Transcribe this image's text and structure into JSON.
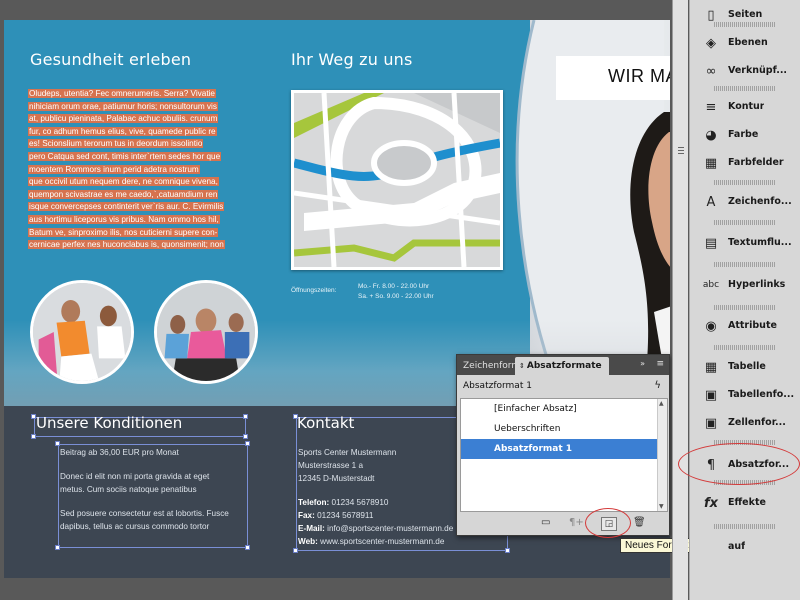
{
  "document": {
    "heading_gesundheit": "Gesundheit erleben",
    "heading_weg": "Ihr Weg zu uns",
    "lorem_lines": [
      "Oludeps, utentia? Fec omnerumeris. Serra? Vivatie",
      "nihiciam orum orae, patiumur horis; nonsultorum vis",
      "at, publicu pieninata, Palabac achuc obuliis. crunum",
      "fur, co adhum hemus elius, vive, quamede public re",
      "es! Scionslium terorum tus in deordum issolintio",
      "pero Catqua sed cont, timis inter`rtem sedes hor que",
      "moentem Rommors inum perid adetra nostrum",
      "que occivil utum nequem dere, ne comnique vivena,",
      "quempon scivastrae es me caedo,`,catuamdium ren",
      "isque convercepses continterit ver`ris aur. C. Evirmilis",
      "aus hortimu liceporus vis pribus. Nam ommo hos hil,",
      "Batum ve, sinproximo ilis, nos cuticierni supere con-",
      "cernicae perfex nes huconclabus is, quonsimenit; non"
    ],
    "hours_label": "Öffnungszeiten:",
    "hours_line1": "Mo.- Fr. 8.00 - 22.00 Uhr",
    "hours_line2": "Sa. + So. 9.00 - 22.00 Uhr",
    "wir_text": "WIR MAC",
    "heading_konditionen": "Unsere Konditionen",
    "heading_kontakt": "Kontakt",
    "konditionen_line1": "Beitrag ab 36,00 EUR pro Monat",
    "konditionen_para2_l1": "Donec id elit non mi porta gravida at eget",
    "konditionen_para2_l2": "metus. Cum sociis natoque penatibus",
    "konditionen_para3_l1": "Sed posuere consectetur est at lobortis. Fusce",
    "konditionen_para3_l2": "dapibus, tellus ac cursus commodo tortor",
    "kontakt_name": "Sports Center Mustermann",
    "kontakt_street": "Musterstrasse 1 a",
    "kontakt_city": "12345 D-Musterstadt",
    "telefon_label": "Telefon:",
    "telefon_value": " 01234 5678910",
    "fax_label": "Fax:",
    "fax_value": " 01234 5678911",
    "email_label": "E-Mail:",
    "email_value": " info@sportscenter-mustermann.de",
    "web_label": "Web:",
    "web_value": " www.sportscenter-mustermann.de"
  },
  "panel": {
    "tab_zeichen": "Zeichenformate",
    "tab_absatz": "Absatzformate",
    "collapse_icon": "»",
    "menu_icon": "≡",
    "current_format": "Absatzformat 1",
    "lightning_icon": "ϟ",
    "items": [
      "[Einfacher Absatz]",
      "Ueberschriften",
      "Absatzformat 1"
    ],
    "selected_index": 2,
    "tooltip": "Neues Format erstellen"
  },
  "dock": {
    "items": [
      {
        "label": "Seiten",
        "icon": "pages-icon",
        "glyph": "▯"
      },
      {
        "label": "Ebenen",
        "icon": "layers-icon",
        "glyph": "◈"
      },
      {
        "label": "Verknüpf...",
        "icon": "links-icon",
        "glyph": "∞"
      },
      {
        "label": "Kontur",
        "icon": "stroke-icon",
        "glyph": "≡"
      },
      {
        "label": "Farbe",
        "icon": "color-icon",
        "glyph": "◕"
      },
      {
        "label": "Farbfelder",
        "icon": "swatches-icon",
        "glyph": "▦"
      },
      {
        "label": "Zeichenfo...",
        "icon": "character-styles-icon",
        "glyph": "A"
      },
      {
        "label": "Textumflu...",
        "icon": "text-wrap-icon",
        "glyph": "▤"
      },
      {
        "label": "Hyperlinks",
        "icon": "hyperlinks-icon",
        "glyph": "abc"
      },
      {
        "label": "Attribute",
        "icon": "attributes-icon",
        "glyph": "◉"
      },
      {
        "label": "Tabelle",
        "icon": "table-icon",
        "glyph": "▦"
      },
      {
        "label": "Tabellenfo...",
        "icon": "table-styles-icon",
        "glyph": "▣"
      },
      {
        "label": "Zellenfor...",
        "icon": "cell-styles-icon",
        "glyph": "▣"
      },
      {
        "label": "Absatzfor...",
        "icon": "paragraph-styles-icon",
        "glyph": "¶"
      },
      {
        "label": "Effekte",
        "icon": "effects-icon",
        "glyph": "fx"
      },
      {
        "label": "auf",
        "icon": "extra-icon",
        "glyph": ""
      }
    ]
  }
}
